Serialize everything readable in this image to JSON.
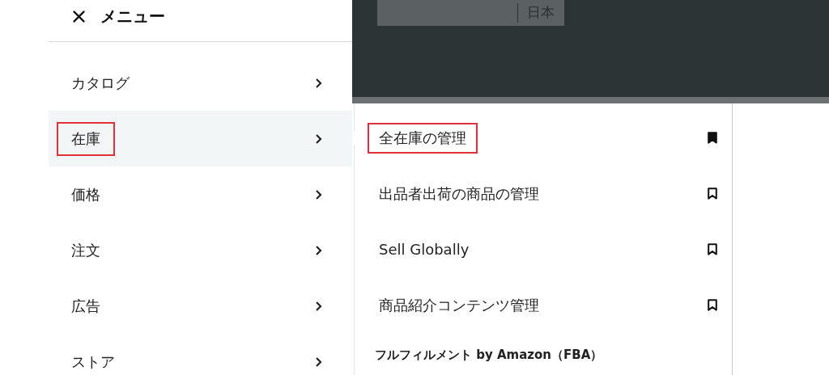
{
  "menu": {
    "title": "メニュー",
    "items": [
      {
        "label": "カタログ",
        "selected": false,
        "highlighted": false
      },
      {
        "label": "在庫",
        "selected": true,
        "highlighted": true
      },
      {
        "label": "価格",
        "selected": false,
        "highlighted": false
      },
      {
        "label": "注文",
        "selected": false,
        "highlighted": false
      },
      {
        "label": "広告",
        "selected": false,
        "highlighted": false
      },
      {
        "label": "ストア",
        "selected": false,
        "highlighted": false
      }
    ]
  },
  "top_bar": {
    "locale": "日本"
  },
  "submenu": {
    "items": [
      {
        "kind": "link",
        "label": "全在庫の管理",
        "bookmarked": true,
        "highlighted": true
      },
      {
        "kind": "link",
        "label": "出品者出荷の商品の管理",
        "bookmarked": false,
        "highlighted": false
      },
      {
        "kind": "link",
        "label": "Sell Globally",
        "bookmarked": false,
        "highlighted": false
      },
      {
        "kind": "link",
        "label": "商品紹介コンテンツ管理",
        "bookmarked": false,
        "highlighted": false
      },
      {
        "kind": "heading",
        "label": "フルフィルメント by Amazon（FBA）"
      }
    ]
  }
}
